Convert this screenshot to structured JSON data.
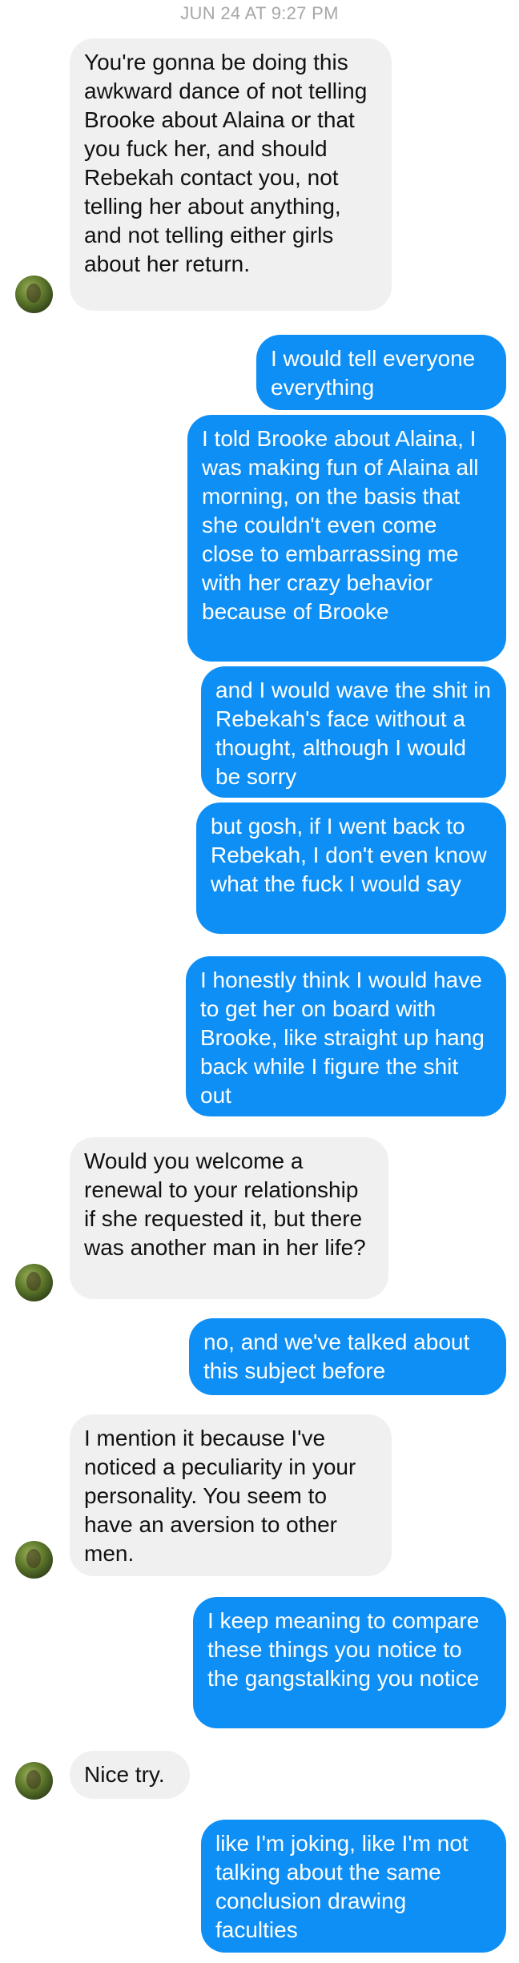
{
  "thread": {
    "timestamp": "JUN 24 AT 9:27 PM"
  },
  "messages": [
    {
      "sender": "them",
      "text": "You're gonna be doing this awkward dance of not telling Brooke about Alaina or that you fuck her,  and should Rebekah contact you, not telling her about anything, and not telling either girls about her return."
    },
    {
      "sender": "me",
      "text": "I would tell everyone everything"
    },
    {
      "sender": "me",
      "text": "I told Brooke about Alaina, I was making fun of Alaina all morning, on the basis that she couldn't even come close to embarrassing me with her crazy behavior because of Brooke"
    },
    {
      "sender": "me",
      "text": "and I would wave the shit in Rebekah's face without a thought, although I would be sorry"
    },
    {
      "sender": "me",
      "text": "but gosh, if I went back to Rebekah, I don't even know what the fuck I would say"
    },
    {
      "sender": "me",
      "text": "I honestly think I would have to get her on board with Brooke, like straight up hang back while I figure the shit out"
    },
    {
      "sender": "them",
      "text": "Would you welcome a renewal to your relationship if she requested it, but there was another man in her life?"
    },
    {
      "sender": "me",
      "text": "no, and we've talked about this subject before"
    },
    {
      "sender": "them",
      "text": "I mention it because I've noticed a peculiarity in your personality. You seem to have an aversion to other men."
    },
    {
      "sender": "me",
      "text": "I keep meaning to compare these things you notice to the gangstalking you notice"
    },
    {
      "sender": "them",
      "text": "Nice try."
    },
    {
      "sender": "me",
      "text": "like I'm joking, like I'm not talking about the same conclusion drawing faculties"
    }
  ],
  "colors": {
    "outgoing_bubble": "#0e8ff5",
    "incoming_bubble": "#f1f0f0",
    "timestamp": "#a7a7a7"
  },
  "icons": {
    "avatar": "contact-avatar"
  }
}
